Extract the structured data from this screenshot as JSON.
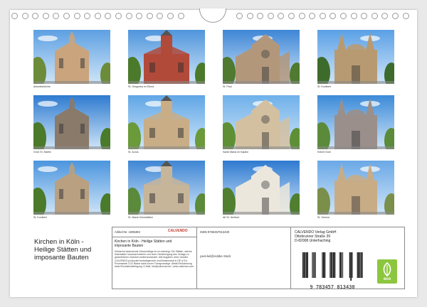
{
  "calendar": {
    "title_lines": [
      "Kirchen in Köln -",
      "Heilige Stätten und",
      "imposante Bauten"
    ],
    "photos": [
      {
        "caption": "Antoniterkirche",
        "sky": "#5da0e2",
        "stone": "#c9a47c",
        "green": "#6c8c3a"
      },
      {
        "caption": "St. Gregorius im Elend",
        "sky": "#4f95dc",
        "stone": "#b24a3a",
        "green": "#4a7a2a"
      },
      {
        "caption": "St. Paul",
        "sky": "#3e86d6",
        "stone": "#b3977a",
        "green": "#4f7a2f"
      },
      {
        "caption": "St. Kunibert",
        "sky": "#5aa0e6",
        "stone": "#b89a72",
        "green": "#3d6b2b"
      },
      {
        "caption": "Groß St. Martin",
        "sky": "#2f7bd0",
        "stone": "#8a7a6a",
        "green": "#4a7a2a"
      },
      {
        "caption": "St. Aurus",
        "sky": "#5fa6e6",
        "stone": "#c8ad86",
        "green": "#6a9a3a"
      },
      {
        "caption": "Sankt Maria im Kapitol",
        "sky": "#6fb0ea",
        "stone": "#d3c0a0",
        "green": "#5f8f35"
      },
      {
        "caption": "Kölner Dom",
        "sky": "#3b8ad8",
        "stone": "#9a8f8a",
        "green": "#5a8a3a"
      },
      {
        "caption": "St. Kunibert",
        "sky": "#4b95de",
        "stone": "#b8a080",
        "green": "#4a7a2a"
      },
      {
        "caption": "St. Maria Himmelfahrt",
        "sky": "#3f86d4",
        "stone": "#c7b59a",
        "green": "#5a8a3a"
      },
      {
        "caption": "Alt St. Heribert",
        "sky": "#2f7ad0",
        "stone": "#ece7dc",
        "green": "#4f7f2f"
      },
      {
        "caption": "St. Gereon",
        "sky": "#6aa8e6",
        "stone": "#c8ac86",
        "green": "#7a8f4a"
      }
    ]
  },
  "info": {
    "article_label": "Artikel-Nr. 1995393",
    "isbn": "ISBN 9783457813430",
    "logo_text": "CALVENDO",
    "product_title_lines": [
      "Kirchen in Köln - Heilige Stätten und",
      "imposante Bauten"
    ],
    "publisher_lines": [
      "CALVENDO Verlag GmbH",
      "Ottobrunner Straße 39",
      "D-82008 Unterhaching"
    ],
    "photo_credit": "yxes-kel@Adobe Stock",
    "description": "Kölnische bedeutende Schutzheilige ist es unterlegt. Die Stätten, welche Kalendaten herausschmieren und ohne Genehmigung des Verlags zu gewerblichen Zwecken weiterverwendet. Alle Angaben ohne Gewähr. CALVENDO produziert bedarfsgerecht und klimaneutral in DE & EU. Prozessfarb CO2 Bilanz dank kurzer Transportwege. Abfall-Reduzierung dank Einzelstückfertigung. E-Mail: info@calvendo.de / www.calvendo.com",
    "barcode_digits": "9 783457 813430",
    "eco_label": "eco"
  },
  "colors": {
    "eco_green": "#8cc63f",
    "logo_red": "#c0392b"
  }
}
